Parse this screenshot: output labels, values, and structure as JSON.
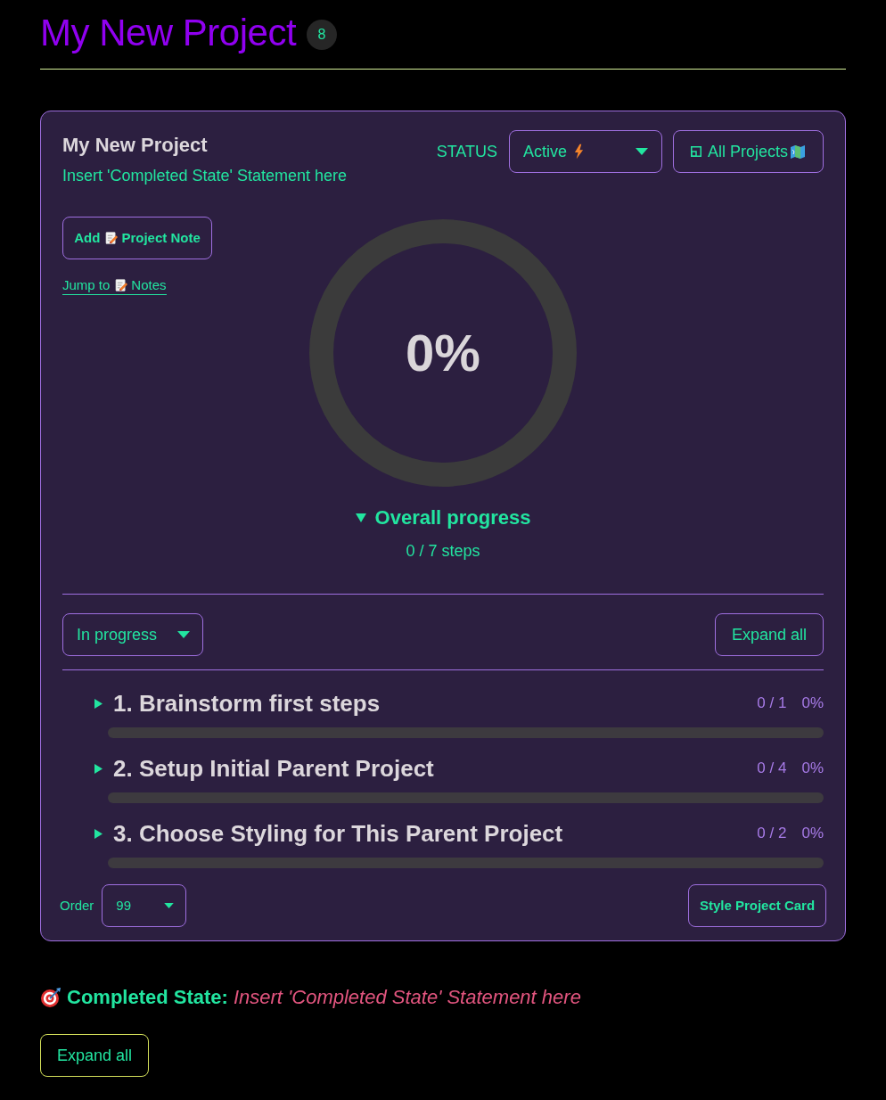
{
  "header": {
    "title": "My New Project",
    "badge": "8"
  },
  "card": {
    "title": "My New Project",
    "statement": "Insert 'Completed State' Statement here",
    "status_label": "STATUS",
    "status_select": {
      "value": "Active"
    },
    "all_projects_button": {
      "label": "All Projects"
    },
    "add_note_button": {
      "label_start": "Add",
      "label_end": "Project Note"
    },
    "jump_link": {
      "label_start": "Jump to",
      "label_end": "Notes"
    },
    "progress_ring": {
      "level": 0,
      "percent": "0%"
    },
    "overall_progress": {
      "label": "Overall progress",
      "expanded": true,
      "steps": "0 / 7 steps"
    },
    "filter_select": {
      "value": "In progress"
    },
    "expand_button": {
      "label": "Expand all"
    },
    "tasks": [
      {
        "title": "1. Brainstorm first steps",
        "count": "0 / 1",
        "percent": "0%",
        "level": 0,
        "expanded": false
      },
      {
        "title": "2. Setup Initial Parent Project",
        "count": "0 / 4",
        "percent": "0%",
        "level": 0,
        "expanded": false
      },
      {
        "title": "3. Choose Styling for This Parent Project",
        "count": "0 / 2",
        "percent": "0%",
        "level": 0,
        "expanded": false
      }
    ],
    "order_label": "Order",
    "order_select": {
      "value": "99"
    },
    "style_button": {
      "label": "Style Project Card"
    }
  },
  "completed_state": {
    "label": "Completed State:",
    "text": "Insert 'Completed State' Statement here"
  },
  "footer_button": {
    "label": "Expand all"
  }
}
